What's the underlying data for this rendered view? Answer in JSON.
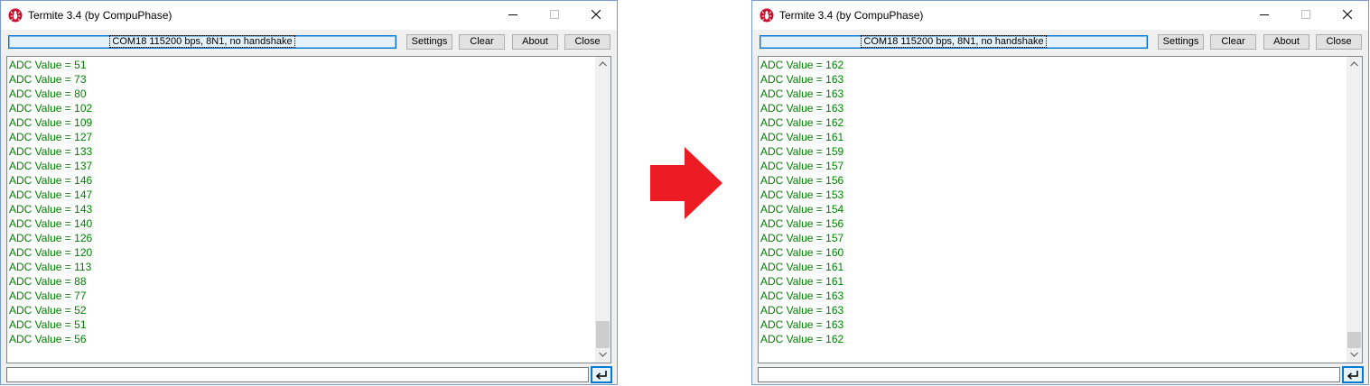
{
  "colors": {
    "log_text": "#008000",
    "arrow": "#ed1c24",
    "focus_border": "#0078d7"
  },
  "transition_icon": "right-arrow-icon",
  "windows": [
    {
      "title": "Termite 3.4 (by CompuPhase)",
      "port_status": "COM18 115200 bps, 8N1, no handshake",
      "buttons": {
        "settings": "Settings",
        "clear": "Clear",
        "about": "About",
        "close": "Close"
      },
      "input_value": "",
      "log": [
        "ADC Value = 51",
        "ADC Value = 73",
        "ADC Value = 80",
        "ADC Value = 102",
        "ADC Value = 109",
        "ADC Value = 127",
        "ADC Value = 133",
        "ADC Value = 137",
        "ADC Value = 146",
        "ADC Value = 147",
        "ADC Value = 143",
        "ADC Value = 140",
        "ADC Value = 126",
        "ADC Value = 120",
        "ADC Value = 113",
        "ADC Value = 88",
        "ADC Value = 77",
        "ADC Value = 52",
        "ADC Value = 51",
        "ADC Value = 56"
      ]
    },
    {
      "title": "Termite 3.4 (by CompuPhase)",
      "port_status": "COM18 115200 bps, 8N1, no handshake",
      "buttons": {
        "settings": "Settings",
        "clear": "Clear",
        "about": "About",
        "close": "Close"
      },
      "input_value": "",
      "log": [
        "ADC Value = 162",
        "ADC Value = 163",
        "ADC Value = 163",
        "ADC Value = 163",
        "ADC Value = 162",
        "ADC Value = 161",
        "ADC Value = 159",
        "ADC Value = 157",
        "ADC Value = 156",
        "ADC Value = 153",
        "ADC Value = 154",
        "ADC Value = 156",
        "ADC Value = 157",
        "ADC Value = 160",
        "ADC Value = 161",
        "ADC Value = 161",
        "ADC Value = 163",
        "ADC Value = 163",
        "ADC Value = 163",
        "ADC Value = 162"
      ]
    }
  ]
}
